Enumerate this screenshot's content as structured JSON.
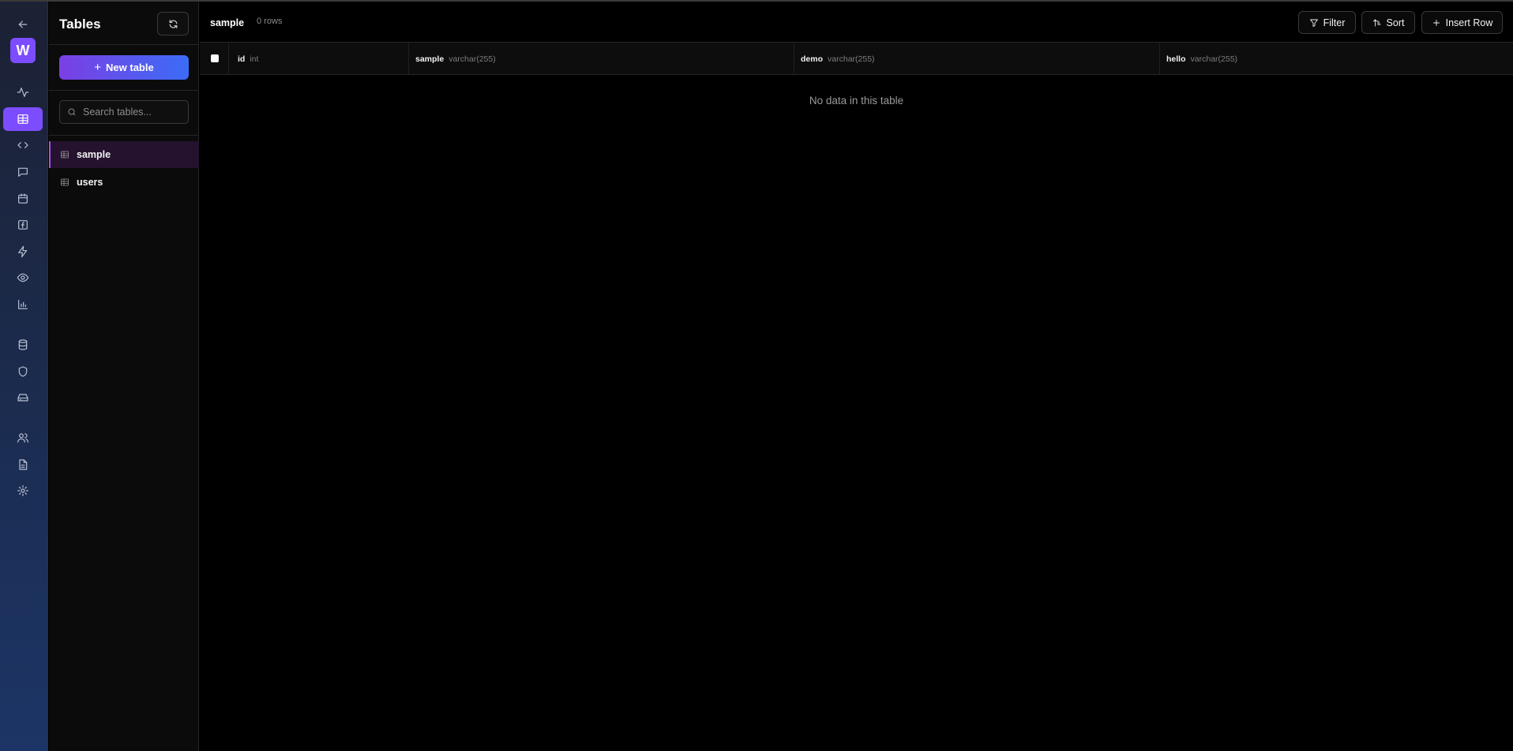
{
  "rail": {
    "logo_letter": "W",
    "items": [
      {
        "icon": "activity-icon"
      },
      {
        "icon": "table-icon",
        "active": true
      },
      {
        "icon": "code-icon"
      },
      {
        "icon": "message-icon"
      },
      {
        "icon": "calendar-icon"
      },
      {
        "icon": "function-icon"
      },
      {
        "icon": "lightning-icon"
      },
      {
        "icon": "eye-icon"
      },
      {
        "icon": "bar-chart-icon"
      },
      {
        "icon": "database-icon"
      },
      {
        "icon": "shield-icon"
      },
      {
        "icon": "drive-icon"
      },
      {
        "icon": "users-icon"
      },
      {
        "icon": "file-text-icon"
      },
      {
        "icon": "gear-icon"
      }
    ]
  },
  "sidebar": {
    "title": "Tables",
    "new_table_label": "New table",
    "search_placeholder": "Search tables...",
    "tables": [
      {
        "name": "sample",
        "active": true
      },
      {
        "name": "users",
        "active": false
      }
    ]
  },
  "main": {
    "table_name": "sample",
    "row_count": "0 rows",
    "filter_label": "Filter",
    "sort_label": "Sort",
    "insert_label": "Insert Row",
    "columns": [
      {
        "name": "id",
        "type": "int"
      },
      {
        "name": "sample",
        "type": "varchar(255)"
      },
      {
        "name": "demo",
        "type": "varchar(255)"
      },
      {
        "name": "hello",
        "type": "varchar(255)"
      }
    ],
    "empty_message": "No data in this table"
  },
  "colors": {
    "accent": "#7c4dff",
    "gradient_start": "#7b3fe4",
    "gradient_end": "#3b6cf6",
    "active_row_bg": "#24122e"
  }
}
